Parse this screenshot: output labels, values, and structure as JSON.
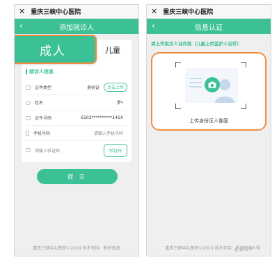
{
  "left": {
    "wx_title": "重庆三峡中心医院",
    "header_title": "添加就诊人",
    "tabs": {
      "adult": "成人",
      "child": "儿童"
    },
    "section_title": "就诊人信息",
    "rows": [
      {
        "label": "证件类型",
        "value": "身份证",
        "action": "点击上传"
      },
      {
        "label": "姓名",
        "value": "罗*"
      },
      {
        "label": "证件号码",
        "value": "6103**********141X"
      },
      {
        "label": "手机号码",
        "placeholder": "请输入手机号码"
      }
    ],
    "code_placeholder": "请输入验证码",
    "code_button": "验证码",
    "submit": "提 交",
    "footer": "重庆三峡中心医院©2019 技术支持：新桥信息"
  },
  "right": {
    "wx_title": "重庆三峡中心医院",
    "header_title": "信息认证",
    "tip": "请上传就诊人证件照（儿童上传监护人证件）",
    "upload_label": "上传身份证人像面",
    "footer": "重庆三峡中心医院©2019 技术支持：新桥信息",
    "watermark": "Caijing"
  },
  "colors": {
    "primary": "#3cc197",
    "highlight": "#f58c3c"
  }
}
